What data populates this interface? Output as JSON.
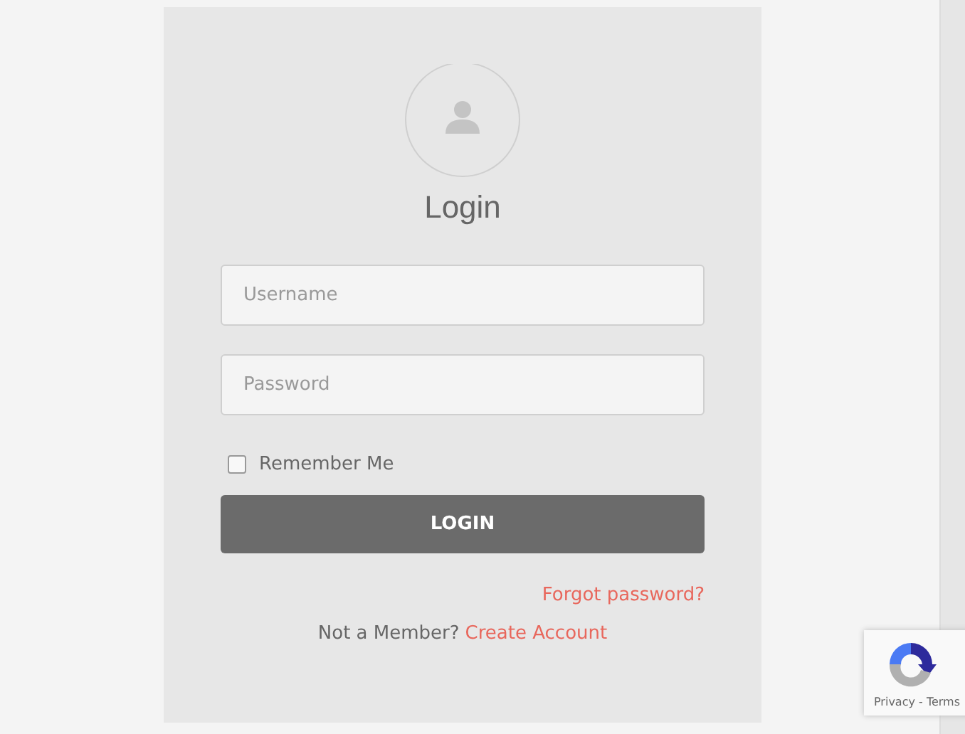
{
  "title": "Login",
  "fields": [
    {
      "placeholder": "Username"
    },
    {
      "placeholder": "Password"
    }
  ],
  "remember": {
    "label": "Remember Me",
    "checked": false
  },
  "button": "LOGIN",
  "forgot": "Forgot password?",
  "signup": {
    "prompt": "Not a Member?",
    "link": "Create Account"
  },
  "recaptcha": {
    "links": "Privacy - Terms"
  }
}
